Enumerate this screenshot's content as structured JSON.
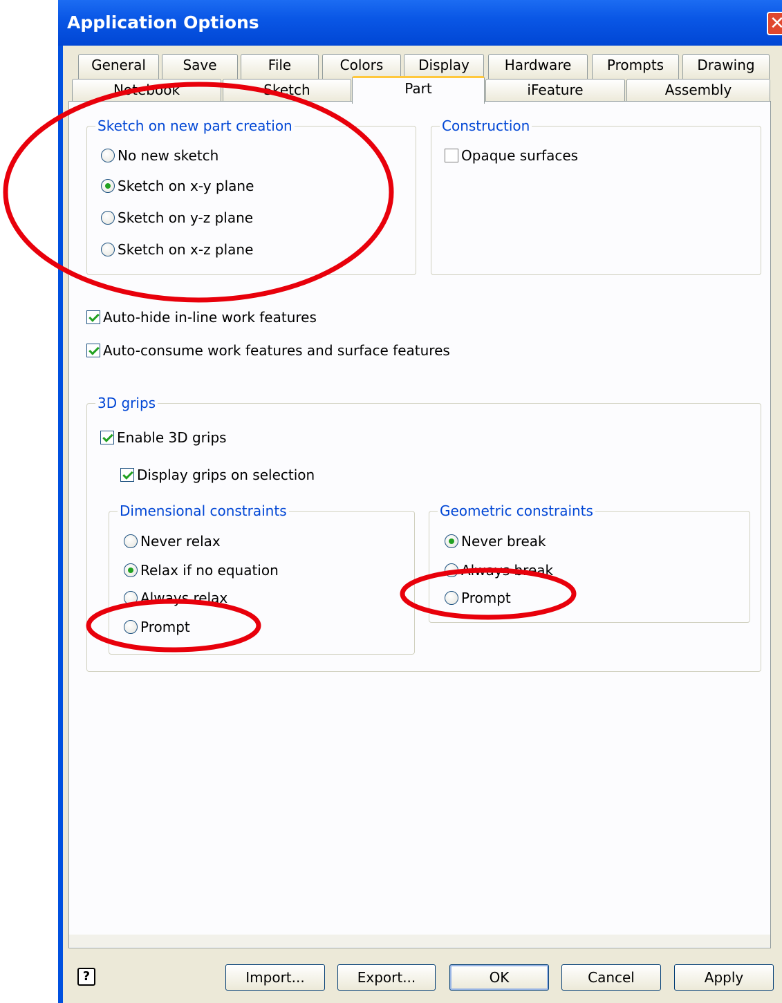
{
  "window": {
    "title": "Application Options",
    "close_icon": "close-icon"
  },
  "tabs_row1": [
    "General",
    "Save",
    "File",
    "Colors",
    "Display",
    "Hardware",
    "Prompts",
    "Drawing"
  ],
  "tabs_row2": [
    "Notebook",
    "Sketch",
    "Part",
    "iFeature",
    "Assembly"
  ],
  "active_tab": "Part",
  "sketch_group": {
    "legend": "Sketch on new part creation",
    "options": [
      "No new sketch",
      "Sketch on x-y plane",
      "Sketch on y-z plane",
      "Sketch on x-z plane"
    ],
    "selected": "Sketch on x-y plane"
  },
  "construction_group": {
    "legend": "Construction",
    "opaque_surfaces": "Opaque surfaces",
    "opaque_checked": false
  },
  "auto_hide": {
    "label": "Auto-hide in-line work features",
    "checked": true
  },
  "auto_consume": {
    "label": "Auto-consume work features and surface features",
    "checked": true
  },
  "grips_group": {
    "legend": "3D grips",
    "enable": {
      "label": "Enable 3D grips",
      "checked": true
    },
    "display": {
      "label": "Display grips on selection",
      "checked": true
    },
    "dimensional": {
      "legend": "Dimensional constraints",
      "options": [
        "Never relax",
        "Relax if no equation",
        "Always relax",
        "Prompt"
      ],
      "selected": "Relax if no equation"
    },
    "geometric": {
      "legend": "Geometric constraints",
      "options": [
        "Never break",
        "Always break",
        "Prompt"
      ],
      "selected": "Never break"
    }
  },
  "buttons": {
    "help": "?",
    "import": "Import...",
    "export": "Export...",
    "ok": "OK",
    "cancel": "Cancel",
    "apply": "Apply"
  },
  "annotation_color": "#e8000b"
}
